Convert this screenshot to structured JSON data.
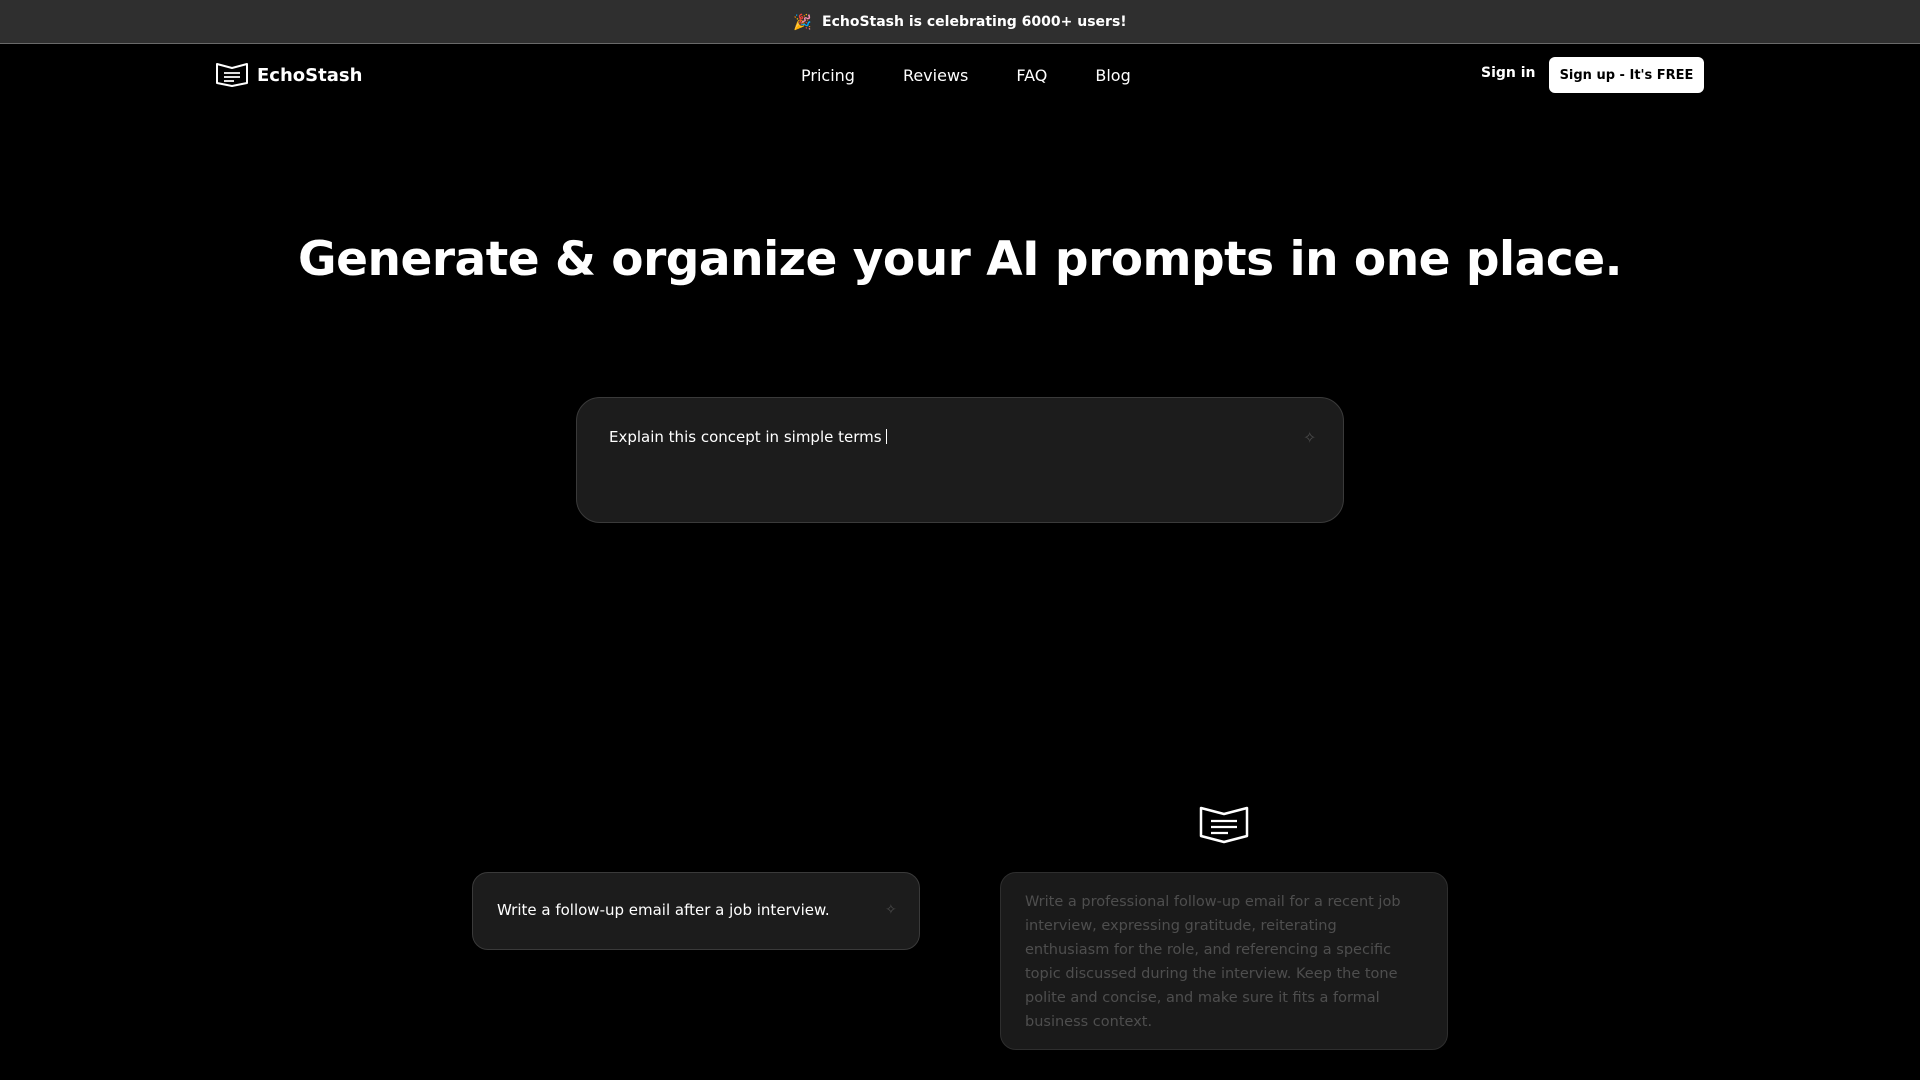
{
  "announcement": {
    "icon": "party-popper-icon",
    "text": "EchoStash is celebrating 6000+ users!"
  },
  "nav": {
    "brand": "EchoStash",
    "links": [
      "Pricing",
      "Reviews",
      "FAQ",
      "Blog"
    ],
    "sign_in": "Sign in",
    "sign_up": "Sign up - It's FREE"
  },
  "hero": {
    "title": "Generate & organize your AI prompts in one place."
  },
  "prompt_input": {
    "value": "Explain this concept in simple terms",
    "icon": "sparkle-icon"
  },
  "demo": {
    "input_text": "Write a follow-up email after a job interview.",
    "output_text": "Write a professional follow-up email for a recent job interview, expressing gratitude, reiterating enthusiasm for the role, and referencing a specific topic discussed during the interview. Keep the tone polite and concise, and make sure it fits a formal business context."
  },
  "colors": {
    "background": "#000000",
    "announcement_bg": "#2f2f2f",
    "card_bg": "#1c1c1c",
    "muted_text": "#4e4e4e"
  }
}
